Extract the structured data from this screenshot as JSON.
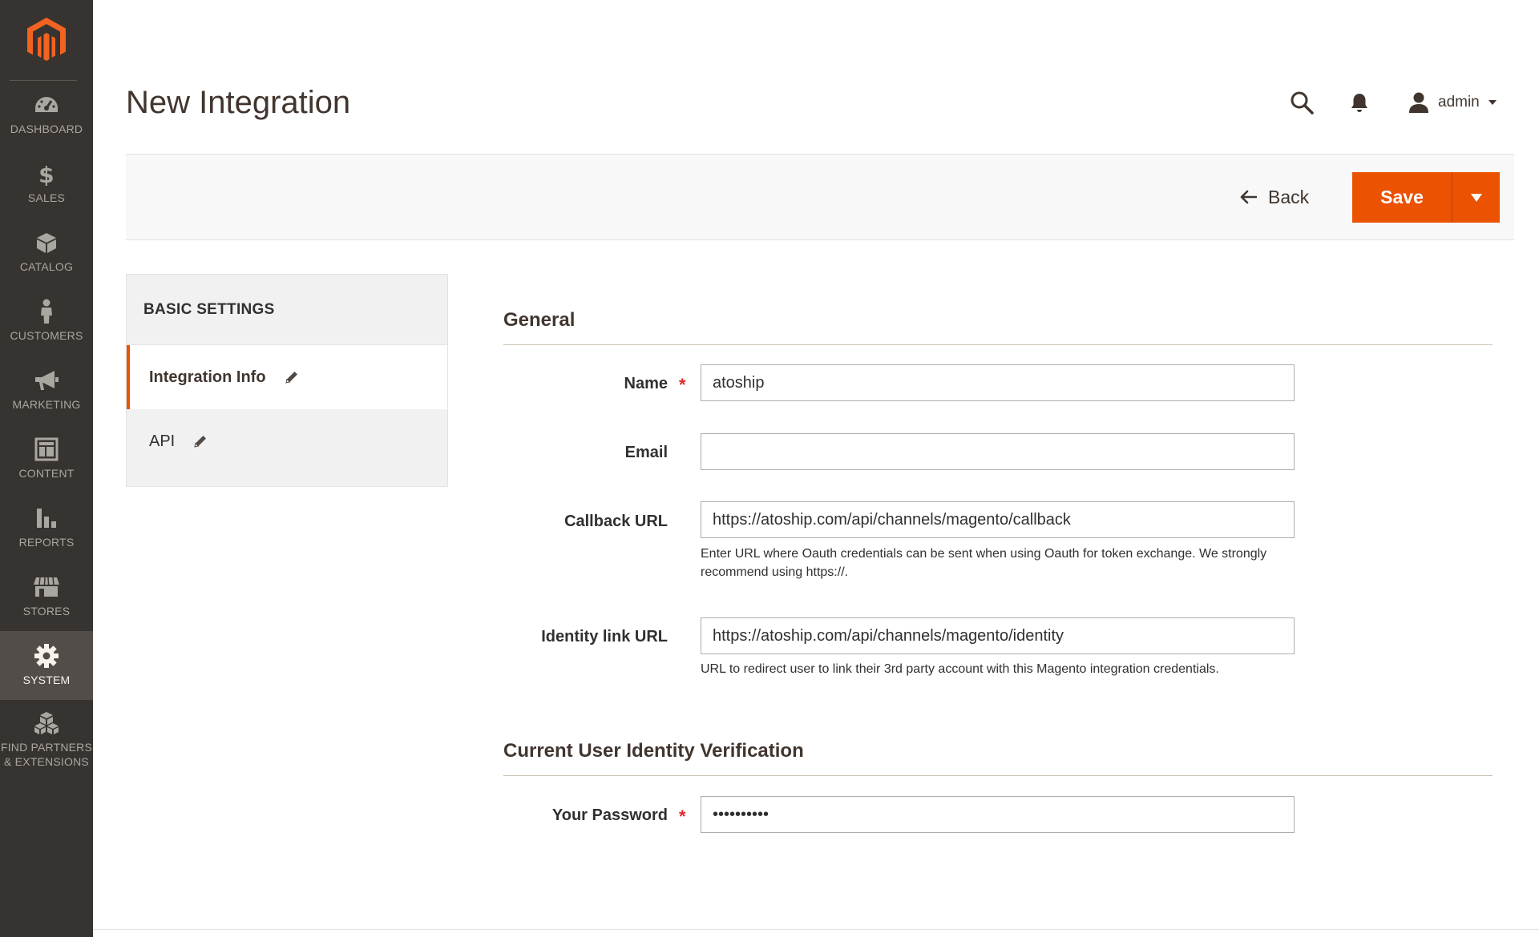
{
  "sidebar": {
    "items": [
      {
        "label": "DASHBOARD",
        "icon": "dashboard-icon"
      },
      {
        "label": "SALES",
        "icon": "dollar-icon"
      },
      {
        "label": "CATALOG",
        "icon": "box-icon"
      },
      {
        "label": "CUSTOMERS",
        "icon": "person-icon"
      },
      {
        "label": "MARKETING",
        "icon": "megaphone-icon"
      },
      {
        "label": "CONTENT",
        "icon": "layout-icon"
      },
      {
        "label": "REPORTS",
        "icon": "bar-chart-icon"
      },
      {
        "label": "STORES",
        "icon": "storefront-icon"
      },
      {
        "label": "SYSTEM",
        "icon": "gear-icon"
      },
      {
        "label": "FIND PARTNERS\n& EXTENSIONS",
        "icon": "cubes-icon"
      }
    ],
    "active": "SYSTEM"
  },
  "header": {
    "title": "New Integration",
    "user": "admin"
  },
  "actions": {
    "back_label": "Back",
    "save_label": "Save"
  },
  "tabs": {
    "heading": "BASIC SETTINGS",
    "items": [
      {
        "label": "Integration Info",
        "active": true
      },
      {
        "label": "API",
        "active": false
      }
    ]
  },
  "form": {
    "general_title": "General",
    "name": {
      "label": "Name",
      "value": "atoship",
      "required": true
    },
    "email": {
      "label": "Email",
      "value": ""
    },
    "callback_url": {
      "label": "Callback URL",
      "value": "https://atoship.com/api/channels/magento/callback",
      "note": "Enter URL where Oauth credentials can be sent when using Oauth for token exchange. We strongly recommend using https://."
    },
    "identity_url": {
      "label": "Identity link URL",
      "value": "https://atoship.com/api/channels/magento/identity",
      "note": "URL to redirect user to link their 3rd party account with this Magento integration credentials."
    },
    "verification_title": "Current User Identity Verification",
    "password": {
      "label": "Your Password",
      "value": "••••••••••",
      "required": true
    }
  },
  "colors": {
    "accent": "#eb5202",
    "sidebar_bg": "#373330",
    "sidebar_active_bg": "#524d49",
    "required_star": "#e22626"
  }
}
